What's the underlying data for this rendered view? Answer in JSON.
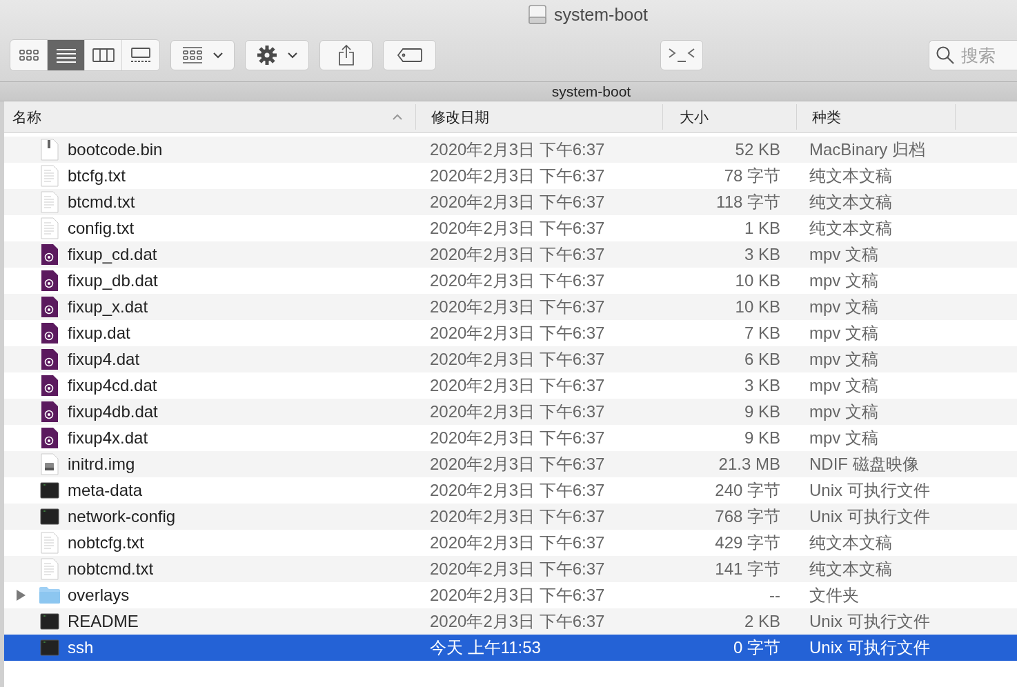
{
  "window": {
    "title": "system-boot"
  },
  "toolbar": {
    "view_modes": [
      {
        "kind": "icons",
        "selected": false
      },
      {
        "kind": "list",
        "selected": true
      },
      {
        "kind": "columns",
        "selected": false
      },
      {
        "kind": "gallery",
        "selected": false
      }
    ],
    "search": {
      "placeholder": "搜索"
    }
  },
  "path_bar": {
    "title": "system-boot"
  },
  "table": {
    "columns": [
      {
        "label": "名称",
        "sorted": true
      },
      {
        "label": "修改日期",
        "sorted": false
      },
      {
        "label": "大小",
        "sorted": false
      },
      {
        "label": "种类",
        "sorted": false
      }
    ],
    "rows": [
      {
        "kind": "archive",
        "name": "bootcode.bin",
        "date": "2020年2月3日 下午6:37",
        "size": "52 KB",
        "type": "MacBinary 归档",
        "selected": false
      },
      {
        "kind": "text",
        "name": "btcfg.txt",
        "date": "2020年2月3日 下午6:37",
        "size": "78 字节",
        "type": "纯文本文稿",
        "selected": false
      },
      {
        "kind": "text",
        "name": "btcmd.txt",
        "date": "2020年2月3日 下午6:37",
        "size": "118 字节",
        "type": "纯文本文稿",
        "selected": false
      },
      {
        "kind": "text",
        "name": "config.txt",
        "date": "2020年2月3日 下午6:37",
        "size": "1 KB",
        "type": "纯文本文稿",
        "selected": false
      },
      {
        "kind": "media",
        "name": "fixup_cd.dat",
        "date": "2020年2月3日 下午6:37",
        "size": "3 KB",
        "type": "mpv 文稿",
        "selected": false
      },
      {
        "kind": "media",
        "name": "fixup_db.dat",
        "date": "2020年2月3日 下午6:37",
        "size": "10 KB",
        "type": "mpv 文稿",
        "selected": false
      },
      {
        "kind": "media",
        "name": "fixup_x.dat",
        "date": "2020年2月3日 下午6:37",
        "size": "10 KB",
        "type": "mpv 文稿",
        "selected": false
      },
      {
        "kind": "media",
        "name": "fixup.dat",
        "date": "2020年2月3日 下午6:37",
        "size": "7 KB",
        "type": "mpv 文稿",
        "selected": false
      },
      {
        "kind": "media",
        "name": "fixup4.dat",
        "date": "2020年2月3日 下午6:37",
        "size": "6 KB",
        "type": "mpv 文稿",
        "selected": false
      },
      {
        "kind": "media",
        "name": "fixup4cd.dat",
        "date": "2020年2月3日 下午6:37",
        "size": "3 KB",
        "type": "mpv 文稿",
        "selected": false
      },
      {
        "kind": "media",
        "name": "fixup4db.dat",
        "date": "2020年2月3日 下午6:37",
        "size": "9 KB",
        "type": "mpv 文稿",
        "selected": false
      },
      {
        "kind": "media",
        "name": "fixup4x.dat",
        "date": "2020年2月3日 下午6:37",
        "size": "9 KB",
        "type": "mpv 文稿",
        "selected": false
      },
      {
        "kind": "disk",
        "name": "initrd.img",
        "date": "2020年2月3日 下午6:37",
        "size": "21.3 MB",
        "type": "NDIF 磁盘映像",
        "selected": false
      },
      {
        "kind": "exec",
        "name": "meta-data",
        "date": "2020年2月3日 下午6:37",
        "size": "240 字节",
        "type": "Unix 可执行文件",
        "selected": false
      },
      {
        "kind": "exec",
        "name": "network-config",
        "date": "2020年2月3日 下午6:37",
        "size": "768 字节",
        "type": "Unix 可执行文件",
        "selected": false
      },
      {
        "kind": "text",
        "name": "nobtcfg.txt",
        "date": "2020年2月3日 下午6:37",
        "size": "429 字节",
        "type": "纯文本文稿",
        "selected": false
      },
      {
        "kind": "text",
        "name": "nobtcmd.txt",
        "date": "2020年2月3日 下午6:37",
        "size": "141 字节",
        "type": "纯文本文稿",
        "selected": false
      },
      {
        "kind": "folder",
        "name": "overlays",
        "date": "2020年2月3日 下午6:37",
        "size": "--",
        "type": "文件夹",
        "selected": false,
        "expanded": false
      },
      {
        "kind": "exec",
        "name": "README",
        "date": "2020年2月3日 下午6:37",
        "size": "2 KB",
        "type": "Unix 可执行文件",
        "selected": false
      },
      {
        "kind": "exec",
        "name": "ssh",
        "date": "今天 上午11:53",
        "size": "0 字节",
        "type": "Unix 可执行文件",
        "selected": true
      }
    ]
  }
}
